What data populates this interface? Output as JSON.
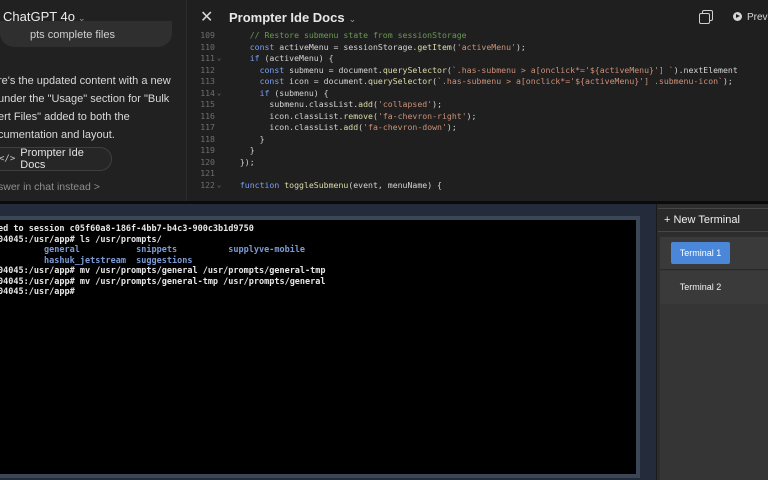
{
  "chat": {
    "title": "ChatGPT 4o",
    "user_bubble_text": "pts complete files",
    "response_lines": [
      "re's the updated content with a new",
      " under the \"Usage\" section for \"Bulk",
      "ert Files\" added to both the",
      "cumentation and layout."
    ],
    "canvas_button_label": "Prompter Ide Docs",
    "canvas_button_icon": "</>",
    "answer_link": "swer in chat instead",
    "answer_link_arrow": ">"
  },
  "editor": {
    "close_icon": "✕",
    "title": "Prompter Ide Docs",
    "title_chevron": "⌄",
    "preview_label": "Previ",
    "lines": [
      {
        "n": "109",
        "fold": "",
        "html": "    <span class=\"c\">// Restore submenu state from sessionStorage</span>"
      },
      {
        "n": "110",
        "fold": "",
        "html": "    <span class=\"k\">const</span> activeMenu = sessionStorage.<span class=\"f\">getItem</span>(<span class=\"s\">'activeMenu'</span>);"
      },
      {
        "n": "111",
        "fold": "⌄",
        "html": "    <span class=\"k\">if</span> (activeMenu) {"
      },
      {
        "n": "112",
        "fold": "",
        "html": "      <span class=\"k\">const</span> submenu = document.<span class=\"f\">querySelector</span>(<span class=\"s\">`.has-submenu &gt; a[onclick*='${activeMenu}'] `</span>).nextElement"
      },
      {
        "n": "113",
        "fold": "",
        "html": "      <span class=\"k\">const</span> icon = document.<span class=\"f\">querySelector</span>(<span class=\"s\">`.has-submenu &gt; a[onclick*='${activeMenu}'] .submenu-icon`</span>);"
      },
      {
        "n": "114",
        "fold": "⌄",
        "html": "      <span class=\"k\">if</span> (submenu) {"
      },
      {
        "n": "115",
        "fold": "",
        "html": "        submenu.classList.<span class=\"f\">add</span>(<span class=\"s\">'collapsed'</span>);"
      },
      {
        "n": "116",
        "fold": "",
        "html": "        icon.classList.<span class=\"f\">remove</span>(<span class=\"s\">'fa-chevron-right'</span>);"
      },
      {
        "n": "117",
        "fold": "",
        "html": "        icon.classList.<span class=\"f\">add</span>(<span class=\"s\">'fa-chevron-down'</span>);"
      },
      {
        "n": "118",
        "fold": "",
        "html": "      }"
      },
      {
        "n": "119",
        "fold": "",
        "html": "    }"
      },
      {
        "n": "120",
        "fold": "",
        "html": "  });"
      },
      {
        "n": "121",
        "fold": "",
        "html": ""
      },
      {
        "n": "122",
        "fold": "⌄",
        "html": "  <span class=\"k\">function</span> <span class=\"f\">toggleSubmenu</span>(event, menuName) {"
      }
    ]
  },
  "terminal": {
    "lines": [
      {
        "text": "ed to session c05f60a8-186f-4bb7-b4c3-900c3b1d9750",
        "kind": "plain"
      },
      {
        "text": "04045:/usr/app# ls /usr/prompts/",
        "kind": "plain"
      },
      {
        "text": "         general           snippets          supplyve-mobile",
        "kind": "dir"
      },
      {
        "text": "         hashuk_jetstream  suggestions",
        "kind": "dir"
      },
      {
        "text": "04045:/usr/app# mv /usr/prompts/general /usr/prompts/general-tmp",
        "kind": "plain"
      },
      {
        "text": "04045:/usr/app# mv /usr/prompts/general-tmp /usr/prompts/general",
        "kind": "plain"
      },
      {
        "text": "04045:/usr/app#",
        "kind": "plain"
      }
    ]
  },
  "sidebar": {
    "new_terminal_label": "+ New Terminal",
    "terminals": [
      {
        "label": "Terminal 1",
        "active": true
      },
      {
        "label": "Terminal 2",
        "active": false
      }
    ]
  },
  "colors": {
    "active_terminal": "#4a87d8",
    "terminal_dir": "#7b9bd6",
    "code_keyword": "#7aa2f7",
    "code_string": "#ce9178"
  }
}
